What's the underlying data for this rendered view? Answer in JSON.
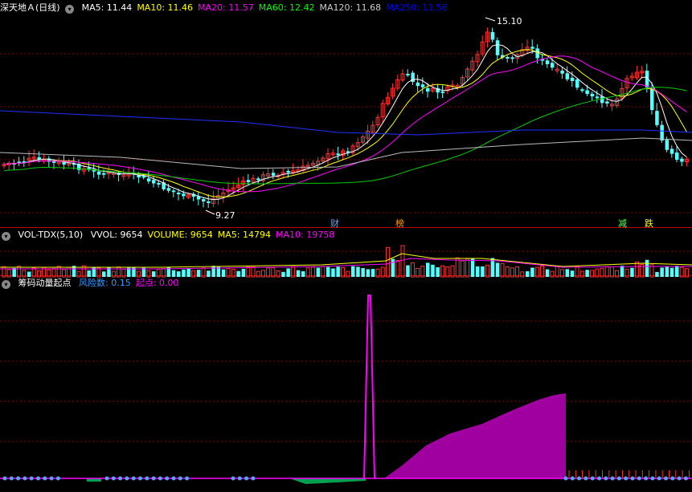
{
  "main_panel": {
    "title": "深天地Ａ(日线)",
    "ma_items": [
      {
        "label": "MA5: 11.44",
        "color": "#ffffff"
      },
      {
        "label": "MA10: 11.46",
        "color": "#ffff00"
      },
      {
        "label": "MA20: 11.57",
        "color": "#ff00ff"
      },
      {
        "label": "MA60: 12.42",
        "color": "#00ff00"
      },
      {
        "label": "MA120: 11.68",
        "color": "#cccccc"
      },
      {
        "label": "MA250: 11.56",
        "color": "#0000ff"
      }
    ],
    "high_label": "15.10",
    "low_label": "9.27",
    "event_tags": [
      {
        "text": "财",
        "color": "#6aa6ff"
      },
      {
        "text": "榜",
        "color": "#ff9900"
      },
      {
        "text": "减",
        "color": "#66ff66"
      },
      {
        "text": "跌",
        "color": "#ffff00"
      }
    ]
  },
  "volume_panel": {
    "title": "VOL-TDX(5,10)",
    "items": [
      {
        "label": "VVOL: 9654",
        "color": "#ffffff"
      },
      {
        "label": "VOLUME: 9654",
        "color": "#ffff00"
      },
      {
        "label": "MA5: 14794",
        "color": "#ffff00"
      },
      {
        "label": "MA10: 19758",
        "color": "#ff00ff"
      }
    ]
  },
  "indicator_panel": {
    "title": "筹码动量起点",
    "items": [
      {
        "label": "风险数: 0.15",
        "color": "#3399ff"
      },
      {
        "label": "起点: 0.00",
        "color": "#ff00ff"
      }
    ]
  },
  "colors": {
    "up": "#ff3333",
    "down": "#54ffff",
    "grid": "#8b0000",
    "separator": "#c00000",
    "indicator_fill": "#a000a0",
    "spike": "#ff00ff",
    "green_fill": "#00a050"
  }
}
